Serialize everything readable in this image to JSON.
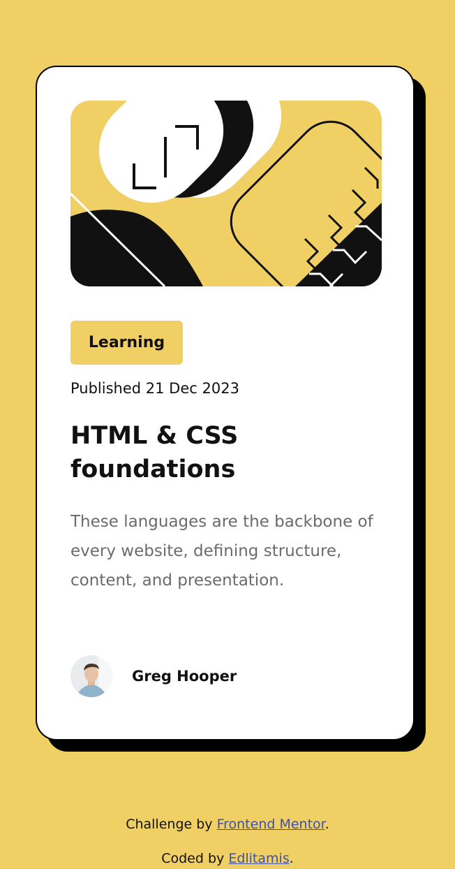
{
  "colors": {
    "background": "#F0D064",
    "card": "#FFFFFF",
    "ink": "#111111",
    "muted_text": "#6B6B6B",
    "link": "#3E52A3"
  },
  "card": {
    "image": {
      "kind": "abstract-illustration",
      "palette": [
        "#F0D064",
        "#111111",
        "#FFFFFF"
      ]
    },
    "tag": "Learning",
    "published": "Published 21 Dec 2023",
    "title": "HTML & CSS foundations",
    "description": "These languages are the backbone of every website, defining structure, content, and presentation.",
    "author": {
      "name": "Greg Hooper",
      "avatar_icon": "user-avatar-photo"
    }
  },
  "attribution": {
    "challenge_prefix": "Challenge by ",
    "challenge_link": "Frontend Mentor",
    "coded_prefix": "Coded by ",
    "coded_link": "Edlitamis",
    "suffix": "."
  }
}
